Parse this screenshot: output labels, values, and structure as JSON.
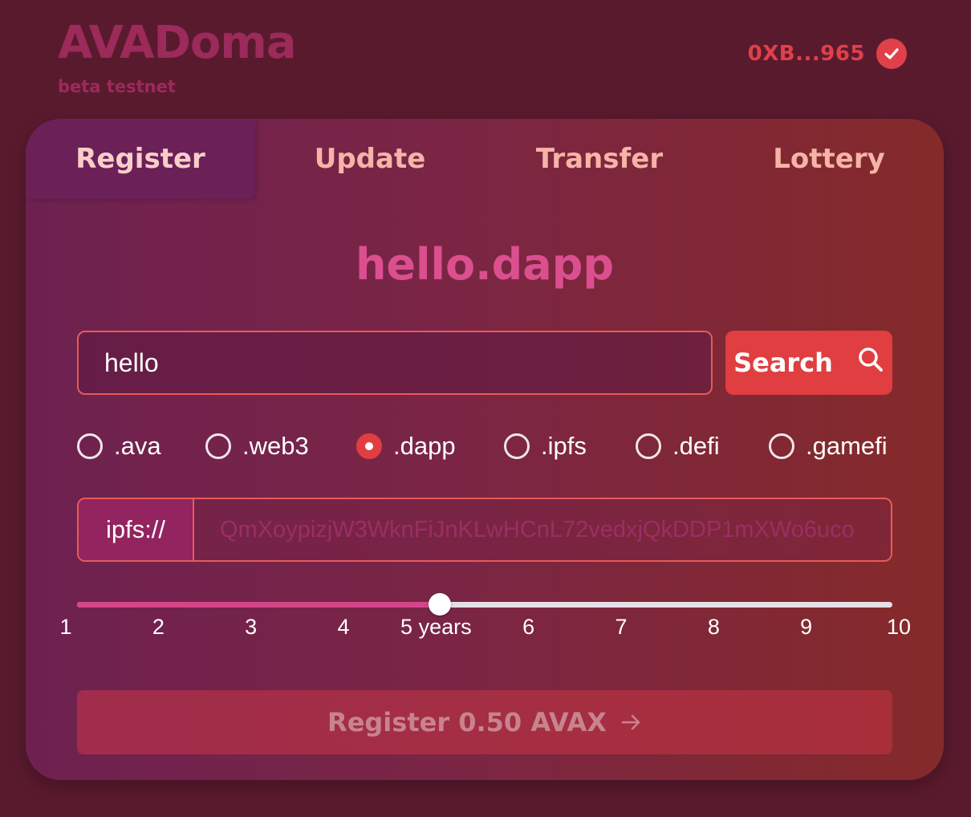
{
  "header": {
    "app_title": "AVADoma",
    "subtitle": "beta testnet",
    "wallet_address": "0XB...965",
    "wallet_icon": "check-circle-icon"
  },
  "tabs": [
    {
      "label": "Register",
      "active": true
    },
    {
      "label": "Update",
      "active": false
    },
    {
      "label": "Transfer",
      "active": false
    },
    {
      "label": "Lottery",
      "active": false
    }
  ],
  "main": {
    "domain_title": "hello.dapp",
    "search": {
      "value": "hello",
      "button_label": "Search",
      "button_icon": "search-icon"
    },
    "tlds": [
      {
        "label": ".ava",
        "selected": false
      },
      {
        "label": ".web3",
        "selected": false
      },
      {
        "label": ".dapp",
        "selected": true
      },
      {
        "label": ".ipfs",
        "selected": false
      },
      {
        "label": ".defi",
        "selected": false
      },
      {
        "label": ".gamefi",
        "selected": false
      }
    ],
    "ipfs": {
      "prefix": "ipfs://",
      "placeholder": "QmXoypizjW3WknFiJnKLwHCnL72vedxjQkDDP1mXWo6uco"
    },
    "duration": {
      "min": 1,
      "max": 10,
      "value": 5,
      "ticks": [
        "1",
        "2",
        "3",
        "4",
        "5 years",
        "6",
        "7",
        "8",
        "9",
        "10"
      ]
    },
    "register_button": {
      "label": "Register 0.50 AVAX",
      "icon": "arrow-right-icon"
    }
  },
  "colors": {
    "accent": "#e03e40",
    "brand": "#9c2a5a",
    "background": "#5a1a2e",
    "title_pink": "#dc4f8f"
  }
}
